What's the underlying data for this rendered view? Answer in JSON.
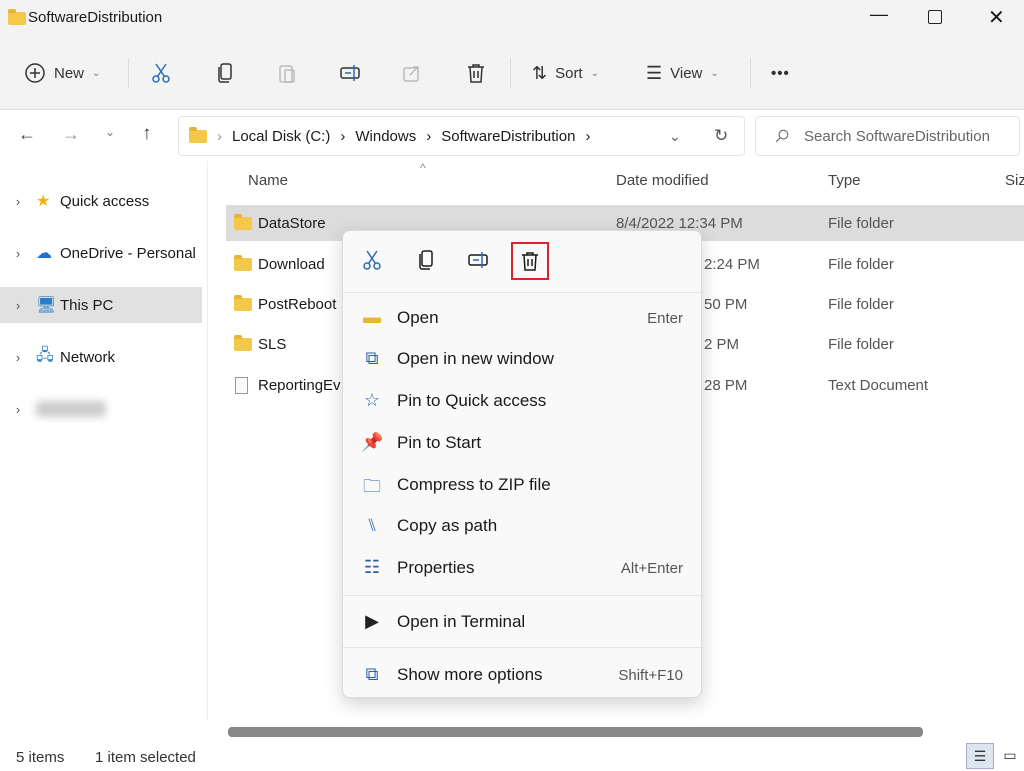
{
  "window": {
    "title": "SoftwareDistribution"
  },
  "toolbar": {
    "new_label": "New",
    "sort_label": "Sort",
    "view_label": "View",
    "more": "•••"
  },
  "address": {
    "path": [
      "Local Disk (C:)",
      "Windows",
      "SoftwareDistribution"
    ],
    "search_placeholder": "Search SoftwareDistribution"
  },
  "sidebar": {
    "items": [
      {
        "label": "Quick access",
        "icon": "star-icon"
      },
      {
        "label": "OneDrive - Personal",
        "icon": "cloud-icon"
      },
      {
        "label": "This PC",
        "icon": "monitor-icon",
        "selected": true
      },
      {
        "label": "Network",
        "icon": "network-icon"
      }
    ]
  },
  "columns": {
    "name": "Name",
    "date": "Date modified",
    "type": "Type",
    "size": "Siz"
  },
  "files": [
    {
      "name": "DataStore",
      "date": "8/4/2022 12:34 PM",
      "type": "File folder",
      "icon": "folder-icon",
      "selected": true
    },
    {
      "name": "Download",
      "date": "2:24 PM",
      "type": "File folder",
      "icon": "folder-icon"
    },
    {
      "name": "PostReboot",
      "date": "50 PM",
      "type": "File folder",
      "icon": "folder-icon"
    },
    {
      "name": "SLS",
      "date": "2 PM",
      "type": "File folder",
      "icon": "folder-icon"
    },
    {
      "name": "ReportingEv",
      "date": "28 PM",
      "type": "Text Document",
      "icon": "document-icon"
    }
  ],
  "context_menu": {
    "items": [
      {
        "label": "Open",
        "shortcut": "Enter"
      },
      {
        "label": "Open in new window",
        "shortcut": ""
      },
      {
        "label": "Pin to Quick access",
        "shortcut": ""
      },
      {
        "label": "Pin to Start",
        "shortcut": ""
      },
      {
        "label": "Compress to ZIP file",
        "shortcut": ""
      },
      {
        "label": "Copy as path",
        "shortcut": ""
      },
      {
        "label": "Properties",
        "shortcut": "Alt+Enter"
      },
      {
        "label": "Open in Terminal",
        "shortcut": ""
      },
      {
        "label": "Show more options",
        "shortcut": "Shift+F10"
      }
    ],
    "highlight_color": "#d9232d"
  },
  "status": {
    "count": "5 items",
    "selection": "1 item selected"
  }
}
